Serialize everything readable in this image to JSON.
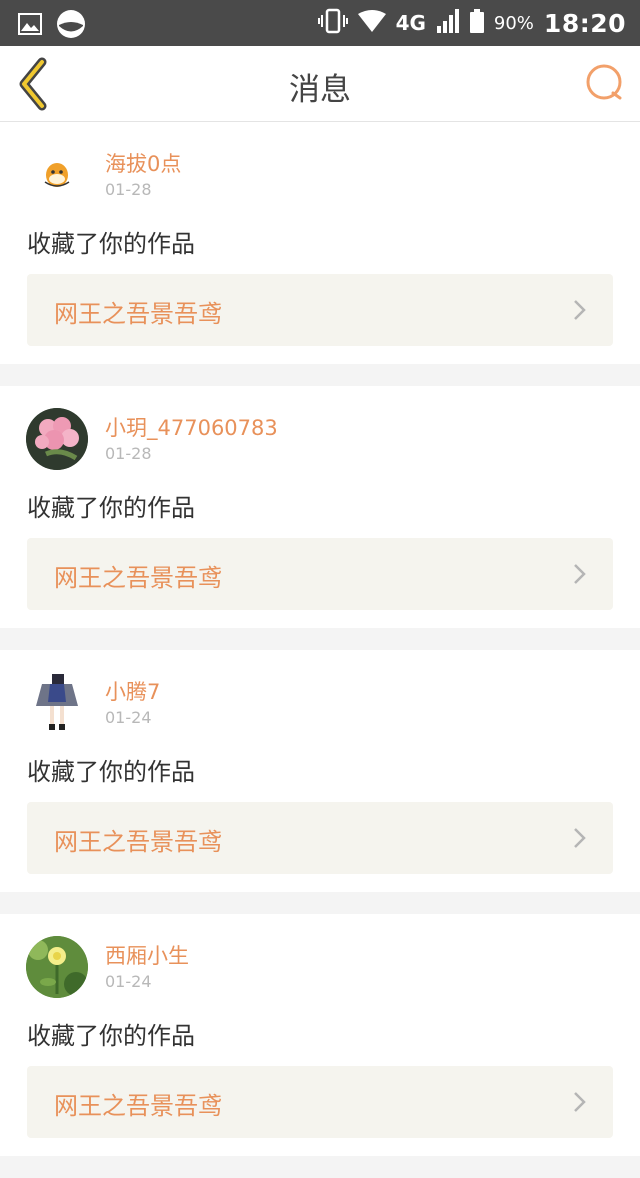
{
  "status_bar": {
    "network": "4G",
    "battery": "90%",
    "time": "18:20"
  },
  "header": {
    "title": "消息"
  },
  "notifications": [
    {
      "username": "海拔0点",
      "date": "01-28",
      "action": "收藏了你的作品",
      "work_title": "网王之吾景吾鸢"
    },
    {
      "username": "小玥_477060783",
      "date": "01-28",
      "action": "收藏了你的作品",
      "work_title": "网王之吾景吾鸢"
    },
    {
      "username": "小腾7",
      "date": "01-24",
      "action": "收藏了你的作品",
      "work_title": "网王之吾景吾鸢"
    },
    {
      "username": "西厢小生",
      "date": "01-24",
      "action": "收藏了你的作品",
      "work_title": "网王之吾景吾鸢"
    }
  ],
  "colors": {
    "accent": "#e8915a",
    "status_bar": "#4a4a4a",
    "back_arrow": "#f0c830"
  }
}
